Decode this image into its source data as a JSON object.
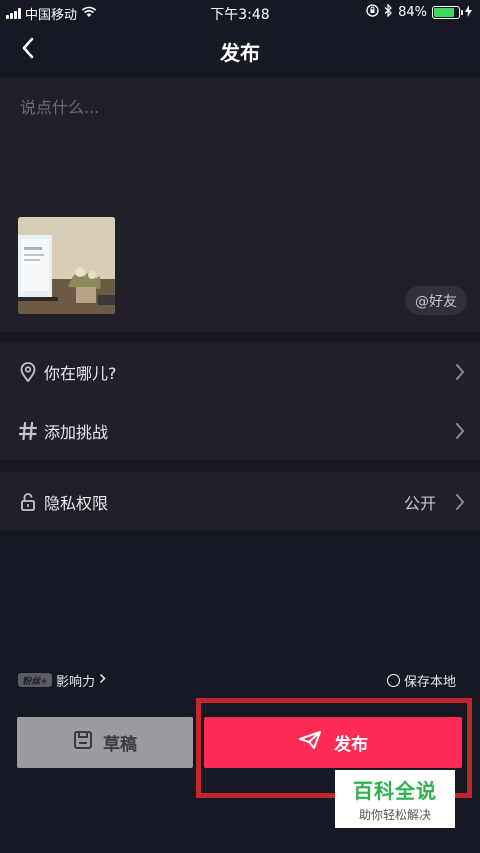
{
  "status_bar": {
    "carrier": "中国移动",
    "time": "下午3:48",
    "battery_percent": "84%",
    "battery_level": 0.84,
    "icons": [
      "signal-icon",
      "wifi-icon",
      "orientation-lock-icon",
      "bluetooth-icon",
      "battery-icon",
      "charging-icon"
    ]
  },
  "header": {
    "title": "发布",
    "back_icon": "chevron-left-icon"
  },
  "compose": {
    "caption_placeholder": "说点什么...",
    "caption_value": "",
    "mention_label": "@好友"
  },
  "options": {
    "location_label": "你在哪儿?",
    "challenge_label": "添加挑战",
    "privacy_label": "隐私权限",
    "privacy_value": "公开"
  },
  "footer": {
    "fans_badge": "粉丝+",
    "influence_label": "影响力",
    "save_local_label": "保存本地",
    "draft_label": "草稿",
    "publish_label": "发布"
  },
  "watermark": {
    "title": "百科全说",
    "subtitle": "助你轻松解决"
  },
  "colors": {
    "background": "#161823",
    "panel": "#1f202a",
    "accent": "#fe2c55",
    "draft_button": "#9b9ca1",
    "highlight": "#c1272d",
    "watermark_green": "#2bb24c"
  }
}
